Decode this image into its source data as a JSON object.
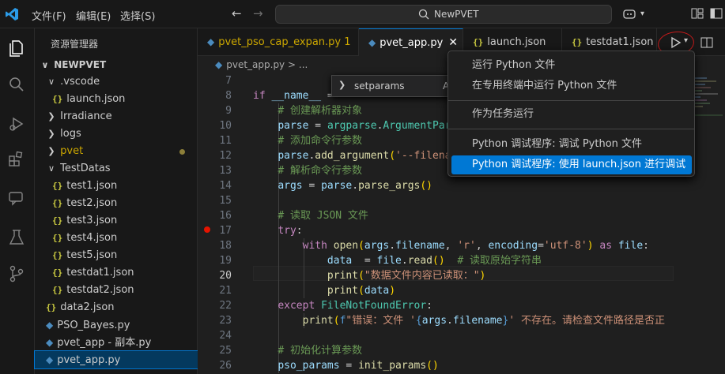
{
  "titlebar": {
    "menus": [
      "文件(F)",
      "编辑(E)",
      "选择(S)"
    ],
    "search_text": "NewPVET"
  },
  "sidebar": {
    "title": "资源管理器",
    "root": "NEWPVET",
    "items": [
      {
        "label": ".vscode",
        "type": "folder-open",
        "indent": 1
      },
      {
        "label": "launch.json",
        "type": "json",
        "indent": 2
      },
      {
        "label": "Irradiance",
        "type": "folder",
        "indent": 1
      },
      {
        "label": "logs",
        "type": "folder",
        "indent": 1
      },
      {
        "label": "pvet",
        "type": "folder",
        "indent": 1,
        "modified": true
      },
      {
        "label": "TestDatas",
        "type": "folder-open",
        "indent": 1
      },
      {
        "label": "test1.json",
        "type": "json",
        "indent": 2
      },
      {
        "label": "test2.json",
        "type": "json",
        "indent": 2
      },
      {
        "label": "test3.json",
        "type": "json",
        "indent": 2
      },
      {
        "label": "test4.json",
        "type": "json",
        "indent": 2
      },
      {
        "label": "test5.json",
        "type": "json",
        "indent": 2
      },
      {
        "label": "testdat1.json",
        "type": "json",
        "indent": 2
      },
      {
        "label": "testdat2.json",
        "type": "json",
        "indent": 2
      },
      {
        "label": "data2.json",
        "type": "json",
        "indent": 1
      },
      {
        "label": "PSO_Bayes.py",
        "type": "py",
        "indent": 1
      },
      {
        "label": "pvet_app - 副本.py",
        "type": "py",
        "indent": 1
      },
      {
        "label": "pvet_app.py",
        "type": "py",
        "indent": 1,
        "selected": true
      }
    ]
  },
  "tabs": [
    {
      "label": "pvet_pso_cap_expan.py",
      "badge": "1",
      "type": "py"
    },
    {
      "label": "pvet_app.py",
      "type": "py",
      "active": true
    },
    {
      "label": "launch.json",
      "type": "json"
    },
    {
      "label": "testdat1.json",
      "type": "json"
    }
  ],
  "breadcrumb": {
    "file": "pvet_app.py",
    "sep": ">",
    "rest": "..."
  },
  "find_widget": {
    "text": "setparams",
    "extra": "A"
  },
  "run_menu": {
    "items": [
      "运行 Python 文件",
      "在专用终端中运行 Python 文件",
      "作为任务运行",
      "Python 调试程序: 调试 Python 文件",
      "Python 调试程序: 使用 launch.json 进行调试"
    ],
    "highlighted": 4
  },
  "editor": {
    "current_line": "20",
    "breakpoint_line": "17",
    "line_numbers": [
      "7",
      "8",
      "9",
      "10",
      "11",
      "12",
      "13",
      "14",
      "15",
      "16",
      "17",
      "18",
      "19",
      "20",
      "21",
      "22",
      "23",
      "24",
      "25",
      "26"
    ]
  },
  "colors": {
    "accent": "#0078d4",
    "breakpoint": "#e51400"
  }
}
